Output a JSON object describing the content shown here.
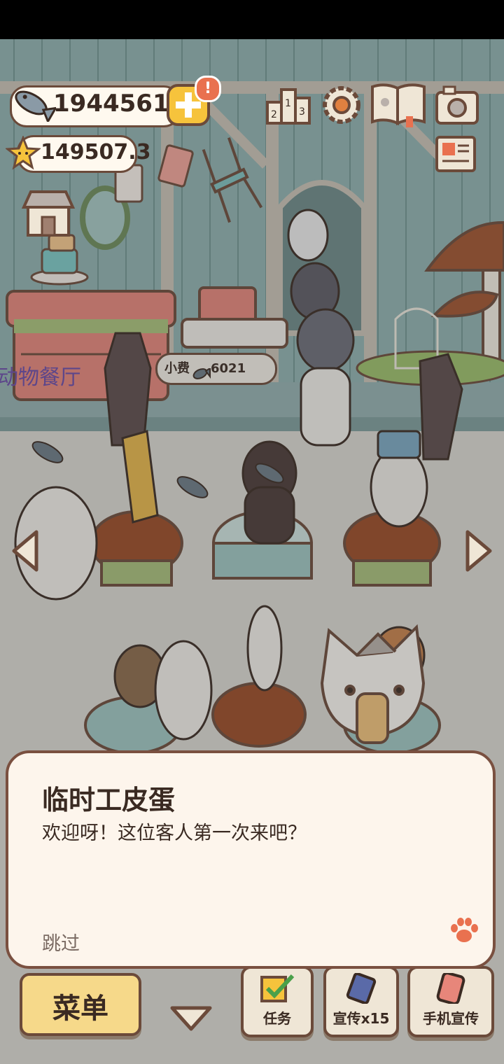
{
  "hud": {
    "fish_currency": "1944561",
    "star_currency": "149507.3",
    "alert_badge": "!"
  },
  "scene": {
    "restaurant_sign": "动物餐厅",
    "tip_bubble_prefix": "小费",
    "tip_bubble_amount": "6021"
  },
  "dialog": {
    "speaker": "临时工皮蛋",
    "text": "欢迎呀！这位客人第一次来吧？",
    "skip_label": "跳过"
  },
  "bottom_bar": {
    "menu_label": "菜单",
    "tasks_label": "任务",
    "promote_label": "宣传x15",
    "phone_promote_label": "手机宣传"
  },
  "colors": {
    "wall": "#7fa3a3",
    "floor": "#d8d6cf",
    "outline": "#6b4a3a",
    "dialog_bg": "#fdf5ec",
    "paw": "#e9714f"
  },
  "icons": [
    "fish-icon",
    "plus-icon",
    "star-icon",
    "leaderboard-icon",
    "gear-icon",
    "book-icon",
    "camera-icon",
    "newspaper-icon",
    "shop-icon",
    "paw-icon",
    "left-arrow-icon",
    "right-arrow-icon",
    "down-arrow-icon",
    "checkbox-icon",
    "flyer-icon",
    "phone-icon"
  ]
}
